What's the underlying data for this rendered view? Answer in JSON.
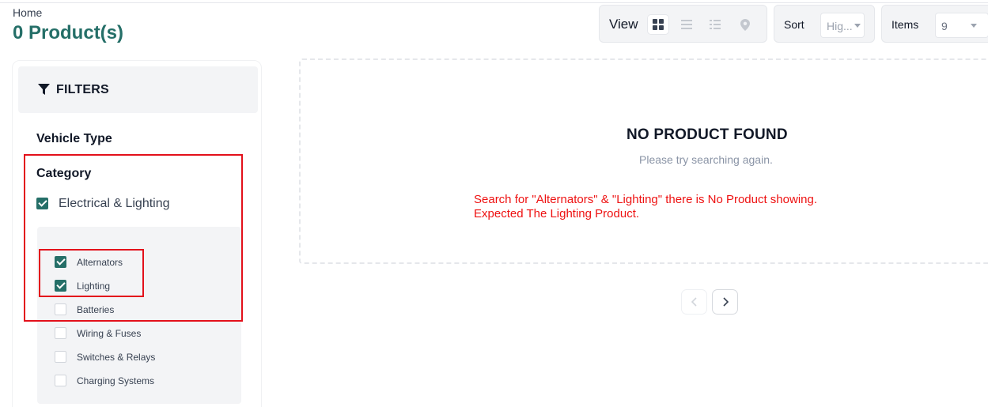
{
  "breadcrumb": "Home",
  "page_title": "0 Product(s)",
  "toolbar": {
    "view_label": "View",
    "view_modes": [
      {
        "icon": "grid-icon",
        "active": true
      },
      {
        "icon": "list-icon",
        "active": false
      },
      {
        "icon": "compact-list-icon",
        "active": false
      },
      {
        "icon": "map-pin-icon",
        "active": false
      }
    ],
    "sort_label": "Sort",
    "sort_value": "Hig...",
    "items_label": "Items",
    "items_value": "9"
  },
  "filters": {
    "title": "FILTERS",
    "vehicle_type_title": "Vehicle Type",
    "category_title": "Category",
    "parent_category": {
      "label": "Electrical & Lighting",
      "checked": true
    },
    "subcategories": [
      {
        "label": "Alternators",
        "checked": true
      },
      {
        "label": "Lighting",
        "checked": true
      },
      {
        "label": "Batteries",
        "checked": false
      },
      {
        "label": "Wiring & Fuses",
        "checked": false
      },
      {
        "label": "Switches & Relays",
        "checked": false
      },
      {
        "label": "Charging Systems",
        "checked": false
      }
    ]
  },
  "results": {
    "empty_title": "NO PRODUCT FOUND",
    "empty_subtitle": "Please try searching again."
  },
  "annotation": {
    "line1": "Search for \"Alternators\" & \"Lighting\" there is No Product showing.",
    "line2": "Expected The Lighting Product."
  },
  "colors": {
    "brand": "#256f68",
    "annotation": "#ee1111",
    "panel_bg": "#f3f4f6"
  }
}
